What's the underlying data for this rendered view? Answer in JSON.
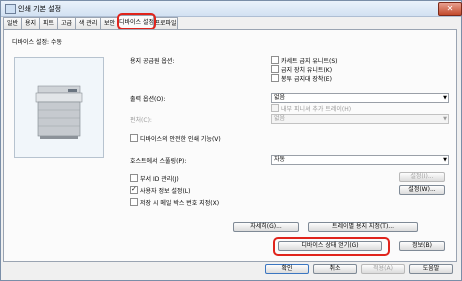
{
  "window": {
    "title": "인쇄 기본 설정",
    "close_label": "✕"
  },
  "tabs": [
    "일반",
    "용지",
    "피트",
    "고급",
    "색 관리",
    "보안",
    "디바이스 설정",
    "프로파일"
  ],
  "active_tab": "디바이스 설정",
  "device_settings_label": "디바이스 설정: 수동",
  "paper_feed": {
    "label": "용지 공급원 옵션:",
    "options": [
      {
        "label": "카세트 급지 유니트(S)",
        "checked": false
      },
      {
        "label": "급지 장치 유니트(K)",
        "checked": false
      },
      {
        "label": "봉투 급지대 장착(E)",
        "checked": false
      }
    ]
  },
  "output": {
    "label": "출력 옵션(O):",
    "value": "없음",
    "inner_tray_label": "내부 피니셔 추가 트레이(H)",
    "punch_label": "펀처(C):",
    "punch_value": "없음"
  },
  "secure_print_label": "디바이스의 안전한 인쇄 기능(V)",
  "spooling": {
    "label": "호스트에서 스풀링(P):",
    "value": "자동"
  },
  "department_id": {
    "label": "부서 ID 관리(J)",
    "checked": false,
    "button": "설정(I)..."
  },
  "user_info": {
    "label": "사용자 정보 설정(L)",
    "checked": true,
    "button": "설정(W)..."
  },
  "mailbox_label": "저장 시 메일 박스 번호 지정(X)",
  "details_button": "자세히(G)...",
  "tray_button": "트레이별 용지 지정(T)...",
  "get_status_button": "디바이스 상태 얻기(G)",
  "info_button": "정보(B)",
  "bottom": {
    "ok": "확인",
    "cancel": "취소",
    "apply": "적용(A)",
    "help": "도움말"
  },
  "colors": {
    "highlight": "#e0241c",
    "panel": "#fbfbfb",
    "window": "#f0f0f0"
  }
}
